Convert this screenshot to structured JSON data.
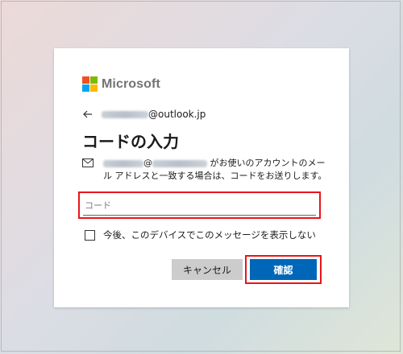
{
  "logo": {
    "text": "Microsoft",
    "colors": [
      "#f25022",
      "#7fba00",
      "#00a4ef",
      "#ffb900"
    ]
  },
  "identity": {
    "email_suffix": "@outlook.jp"
  },
  "title": "コードの入力",
  "message": {
    "at_sign": "@",
    "line1_tail": "がお使いのアカウントのメー",
    "line2": "ル アドレスと一致する場合は、コードをお送りします。"
  },
  "code_input": {
    "placeholder": "コード",
    "value": ""
  },
  "remember": {
    "label": "今後、このデバイスでこのメッセージを表示しない",
    "checked": false
  },
  "buttons": {
    "cancel": "キャンセル",
    "confirm": "確認"
  },
  "colors": {
    "primary": "#0067b8",
    "highlight": "#e8141c"
  }
}
